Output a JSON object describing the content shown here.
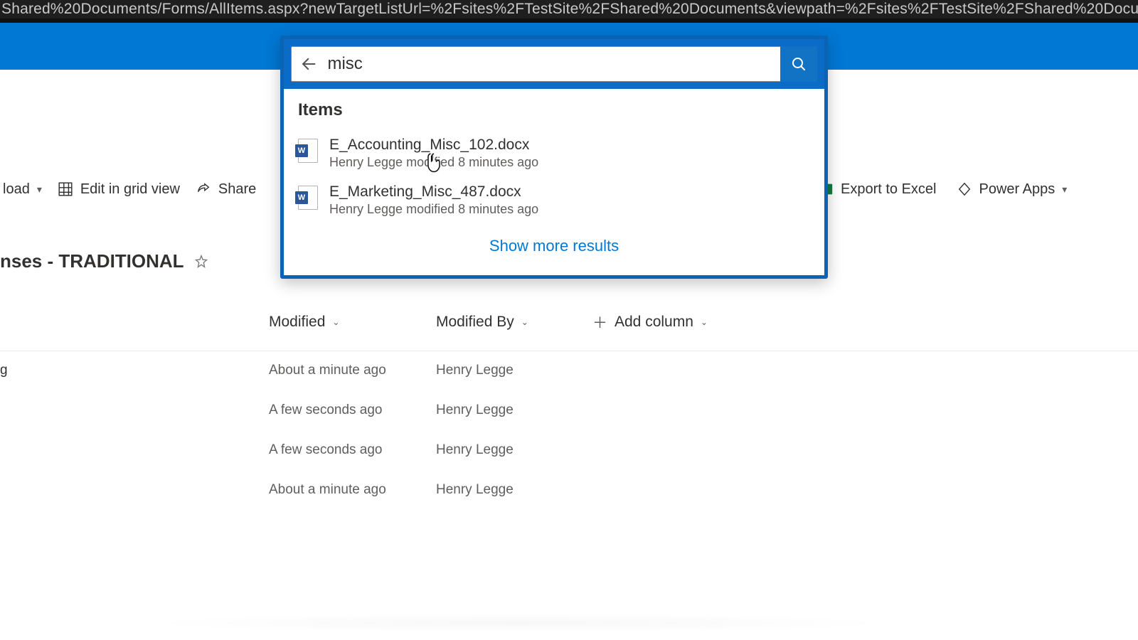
{
  "address_bar": "Shared%20Documents/Forms/AllItems.aspx?newTargetListUrl=%2Fsites%2FTestSite%2FShared%20Documents&viewpath=%2Fsites%2FTestSite%2FShared%20Docu",
  "search": {
    "query": "misc",
    "items_header": "Items",
    "show_more": "Show more results",
    "results": [
      {
        "title": "E_Accounting_Misc_102.docx",
        "sub": "Henry Legge modified 8 minutes ago"
      },
      {
        "title": "E_Marketing_Misc_487.docx",
        "sub": "Henry Legge modified 8 minutes ago"
      }
    ]
  },
  "toolbar": {
    "upload": "load",
    "edit_grid": "Edit in grid view",
    "share": "Share",
    "export_excel": "Export to Excel",
    "power_apps": "Power Apps"
  },
  "library": {
    "title": "nses - TRADITIONAL"
  },
  "columns": {
    "modified": "Modified",
    "modified_by": "Modified By",
    "add_column": "Add column"
  },
  "rows": [
    {
      "name": "g",
      "modified": "About a minute ago",
      "modified_by": "Henry Legge"
    },
    {
      "name": "",
      "modified": "A few seconds ago",
      "modified_by": "Henry Legge"
    },
    {
      "name": "",
      "modified": "A few seconds ago",
      "modified_by": "Henry Legge"
    },
    {
      "name": "",
      "modified": "About a minute ago",
      "modified_by": "Henry Legge"
    }
  ]
}
